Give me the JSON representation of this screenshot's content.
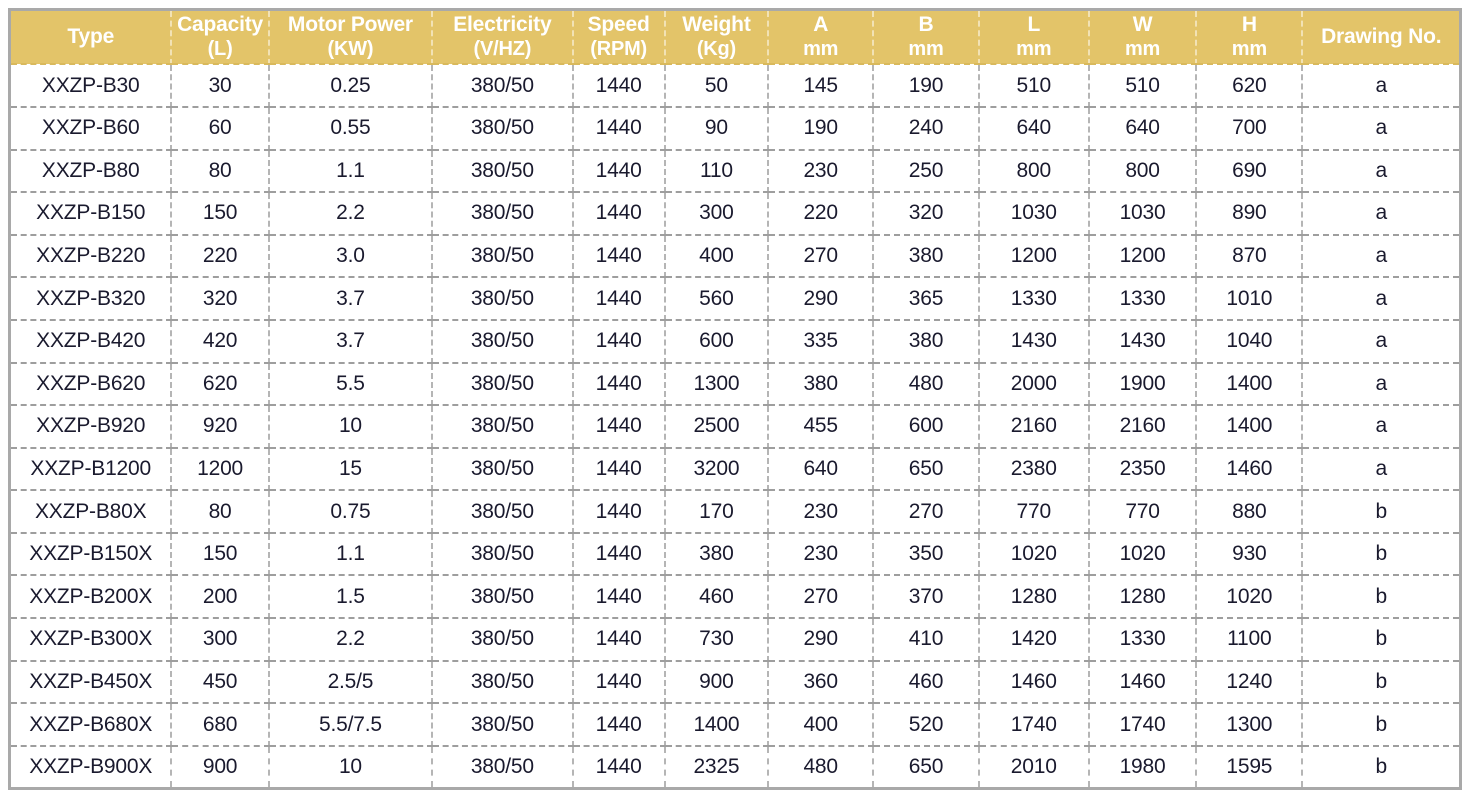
{
  "table": {
    "columns": [
      {
        "label": "Type",
        "unit": ""
      },
      {
        "label": "Capacity",
        "unit": "(L)"
      },
      {
        "label": "Motor Power",
        "unit": "(KW)"
      },
      {
        "label": "Electricity",
        "unit": "(V/HZ)"
      },
      {
        "label": "Speed",
        "unit": "(RPM)"
      },
      {
        "label": "Weight",
        "unit": "(Kg)"
      },
      {
        "label": "A",
        "unit": "mm"
      },
      {
        "label": "B",
        "unit": "mm"
      },
      {
        "label": "L",
        "unit": "mm"
      },
      {
        "label": "W",
        "unit": "mm"
      },
      {
        "label": "H",
        "unit": "mm"
      },
      {
        "label": "Drawing No.",
        "unit": ""
      }
    ],
    "rows": [
      {
        "type": "XXZP-B30",
        "capacity": "30",
        "motor_power": "0.25",
        "electricity": "380/50",
        "speed": "1440",
        "weight": "50",
        "a": "145",
        "b": "190",
        "l": "510",
        "w": "510",
        "h": "620",
        "drawing_no": "a"
      },
      {
        "type": "XXZP-B60",
        "capacity": "60",
        "motor_power": "0.55",
        "electricity": "380/50",
        "speed": "1440",
        "weight": "90",
        "a": "190",
        "b": "240",
        "l": "640",
        "w": "640",
        "h": "700",
        "drawing_no": "a"
      },
      {
        "type": "XXZP-B80",
        "capacity": "80",
        "motor_power": "1.1",
        "electricity": "380/50",
        "speed": "1440",
        "weight": "110",
        "a": "230",
        "b": "250",
        "l": "800",
        "w": "800",
        "h": "690",
        "drawing_no": "a"
      },
      {
        "type": "XXZP-B150",
        "capacity": "150",
        "motor_power": "2.2",
        "electricity": "380/50",
        "speed": "1440",
        "weight": "300",
        "a": "220",
        "b": "320",
        "l": "1030",
        "w": "1030",
        "h": "890",
        "drawing_no": "a"
      },
      {
        "type": "XXZP-B220",
        "capacity": "220",
        "motor_power": "3.0",
        "electricity": "380/50",
        "speed": "1440",
        "weight": "400",
        "a": "270",
        "b": "380",
        "l": "1200",
        "w": "1200",
        "h": "870",
        "drawing_no": "a"
      },
      {
        "type": "XXZP-B320",
        "capacity": "320",
        "motor_power": "3.7",
        "electricity": "380/50",
        "speed": "1440",
        "weight": "560",
        "a": "290",
        "b": "365",
        "l": "1330",
        "w": "1330",
        "h": "1010",
        "drawing_no": "a"
      },
      {
        "type": "XXZP-B420",
        "capacity": "420",
        "motor_power": "3.7",
        "electricity": "380/50",
        "speed": "1440",
        "weight": "600",
        "a": "335",
        "b": "380",
        "l": "1430",
        "w": "1430",
        "h": "1040",
        "drawing_no": "a"
      },
      {
        "type": "XXZP-B620",
        "capacity": "620",
        "motor_power": "5.5",
        "electricity": "380/50",
        "speed": "1440",
        "weight": "1300",
        "a": "380",
        "b": "480",
        "l": "2000",
        "w": "1900",
        "h": "1400",
        "drawing_no": "a"
      },
      {
        "type": "XXZP-B920",
        "capacity": "920",
        "motor_power": "10",
        "electricity": "380/50",
        "speed": "1440",
        "weight": "2500",
        "a": "455",
        "b": "600",
        "l": "2160",
        "w": "2160",
        "h": "1400",
        "drawing_no": "a"
      },
      {
        "type": "XXZP-B1200",
        "capacity": "1200",
        "motor_power": "15",
        "electricity": "380/50",
        "speed": "1440",
        "weight": "3200",
        "a": "640",
        "b": "650",
        "l": "2380",
        "w": "2350",
        "h": "1460",
        "drawing_no": "a"
      },
      {
        "type": "XXZP-B80X",
        "capacity": "80",
        "motor_power": "0.75",
        "electricity": "380/50",
        "speed": "1440",
        "weight": "170",
        "a": "230",
        "b": "270",
        "l": "770",
        "w": "770",
        "h": "880",
        "drawing_no": "b"
      },
      {
        "type": "XXZP-B150X",
        "capacity": "150",
        "motor_power": "1.1",
        "electricity": "380/50",
        "speed": "1440",
        "weight": "380",
        "a": "230",
        "b": "350",
        "l": "1020",
        "w": "1020",
        "h": "930",
        "drawing_no": "b"
      },
      {
        "type": "XXZP-B200X",
        "capacity": "200",
        "motor_power": "1.5",
        "electricity": "380/50",
        "speed": "1440",
        "weight": "460",
        "a": "270",
        "b": "370",
        "l": "1280",
        "w": "1280",
        "h": "1020",
        "drawing_no": "b"
      },
      {
        "type": "XXZP-B300X",
        "capacity": "300",
        "motor_power": "2.2",
        "electricity": "380/50",
        "speed": "1440",
        "weight": "730",
        "a": "290",
        "b": "410",
        "l": "1420",
        "w": "1330",
        "h": "1100",
        "drawing_no": "b"
      },
      {
        "type": "XXZP-B450X",
        "capacity": "450",
        "motor_power": "2.5/5",
        "electricity": "380/50",
        "speed": "1440",
        "weight": "900",
        "a": "360",
        "b": "460",
        "l": "1460",
        "w": "1460",
        "h": "1240",
        "drawing_no": "b"
      },
      {
        "type": "XXZP-B680X",
        "capacity": "680",
        "motor_power": "5.5/7.5",
        "electricity": "380/50",
        "speed": "1440",
        "weight": "1400",
        "a": "400",
        "b": "520",
        "l": "1740",
        "w": "1740",
        "h": "1300",
        "drawing_no": "b"
      },
      {
        "type": "XXZP-B900X",
        "capacity": "900",
        "motor_power": "10",
        "electricity": "380/50",
        "speed": "1440",
        "weight": "2325",
        "a": "480",
        "b": "650",
        "l": "2010",
        "w": "1980",
        "h": "1595",
        "drawing_no": "b"
      }
    ]
  },
  "colors": {
    "header_background": "#e3c469",
    "header_text": "#ffffff",
    "body_text": "#1a1a2e",
    "outer_border": "#a9a9a9",
    "body_divider": "#b5b5b5"
  }
}
